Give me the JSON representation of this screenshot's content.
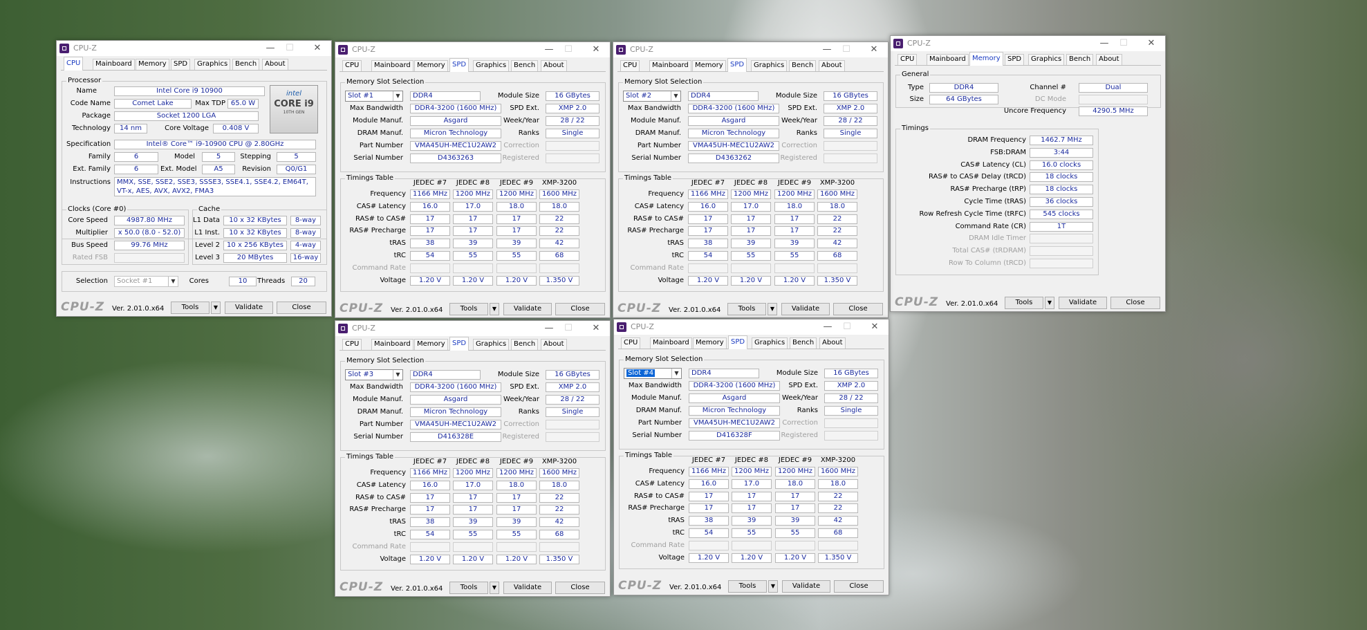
{
  "app": {
    "title": "CPU-Z",
    "tabs": [
      "CPU",
      "Mainboard",
      "Memory",
      "SPD",
      "Graphics",
      "Bench",
      "About"
    ],
    "footer_logo": "CPU-Z",
    "version": "Ver. 2.01.0.x64",
    "tools_label": "Tools",
    "validate_label": "Validate",
    "close_label": "Close",
    "window_buttons": {
      "minimize": "—",
      "maximize": "☐",
      "close": "✕"
    }
  },
  "cpu": {
    "processor_group": "Processor",
    "name_label": "Name",
    "name": "Intel Core i9 10900",
    "codename_label": "Code Name",
    "codename": "Comet Lake",
    "maxtdp_label": "Max TDP",
    "maxtdp": "65.0 W",
    "package_label": "Package",
    "package": "Socket 1200 LGA",
    "technology_label": "Technology",
    "technology": "14 nm",
    "corevoltage_label": "Core Voltage",
    "corevoltage": "0.408 V",
    "spec_label": "Specification",
    "spec": "Intel® Core™ i9-10900 CPU @ 2.80GHz",
    "family_label": "Family",
    "family": "6",
    "model_label": "Model",
    "model": "5",
    "stepping_label": "Stepping",
    "stepping": "5",
    "extfamily_label": "Ext. Family",
    "extfamily": "6",
    "extmodel_label": "Ext. Model",
    "extmodel": "A5",
    "revision_label": "Revision",
    "revision": "Q0/G1",
    "instructions_label": "Instructions",
    "instructions": "MMX, SSE, SSE2, SSE3, SSSE3, SSE4.1, SSE4.2, EM64T, VT-x, AES, AVX, AVX2, FMA3",
    "logo_brand": "intel",
    "logo_core": "CORE i9",
    "logo_gen": "10TH GEN",
    "clocks_group": "Clocks (Core #0)",
    "corespeed_label": "Core Speed",
    "corespeed": "4987.80 MHz",
    "multiplier_label": "Multiplier",
    "multiplier": "x 50.0 (8.0 - 52.0)",
    "busspeed_label": "Bus Speed",
    "busspeed": "99.76 MHz",
    "ratedfsb_label": "Rated FSB",
    "ratedfsb": "",
    "cache_group": "Cache",
    "l1d_label": "L1 Data",
    "l1d": "10 x 32 KBytes",
    "l1d_way": "8-way",
    "l1i_label": "L1 Inst.",
    "l1i": "10 x 32 KBytes",
    "l1i_way": "8-way",
    "l2_label": "Level 2",
    "l2": "10 x 256 KBytes",
    "l2_way": "4-way",
    "l3_label": "Level 3",
    "l3": "20 MBytes",
    "l3_way": "16-way",
    "selection_label": "Selection",
    "selection": "Socket #1",
    "cores_label": "Cores",
    "cores": "10",
    "threads_label": "Threads",
    "threads": "20"
  },
  "memory": {
    "general_group": "General",
    "type_label": "Type",
    "type": "DDR4",
    "size_label": "Size",
    "size": "64 GBytes",
    "channel_label": "Channel #",
    "channel": "Dual",
    "dcmode_label": "DC Mode",
    "dcmode": "",
    "uncore_label": "Uncore Frequency",
    "uncore": "4290.5 MHz",
    "timings_group": "Timings",
    "rows": [
      {
        "label": "DRAM Frequency",
        "value": "1462.7 MHz",
        "disabled": false
      },
      {
        "label": "FSB:DRAM",
        "value": "3:44",
        "disabled": false
      },
      {
        "label": "CAS# Latency (CL)",
        "value": "16.0 clocks",
        "disabled": false
      },
      {
        "label": "RAS# to CAS# Delay (tRCD)",
        "value": "18 clocks",
        "disabled": false
      },
      {
        "label": "RAS# Precharge (tRP)",
        "value": "18 clocks",
        "disabled": false
      },
      {
        "label": "Cycle Time (tRAS)",
        "value": "36 clocks",
        "disabled": false
      },
      {
        "label": "Row Refresh Cycle Time (tRFC)",
        "value": "545 clocks",
        "disabled": false
      },
      {
        "label": "Command Rate (CR)",
        "value": "1T",
        "disabled": false
      },
      {
        "label": "DRAM Idle Timer",
        "value": "",
        "disabled": true
      },
      {
        "label": "Total CAS# (tRDRAM)",
        "value": "",
        "disabled": true
      },
      {
        "label": "Row To Column (tRCD)",
        "value": "",
        "disabled": true
      }
    ]
  },
  "spd_labels": {
    "slot_group": "Memory Slot Selection",
    "module_size": "Module Size",
    "max_bandwidth": "Max Bandwidth",
    "spd_ext": "SPD Ext.",
    "module_manuf": "Module Manuf.",
    "week_year": "Week/Year",
    "dram_manuf": "DRAM Manuf.",
    "ranks": "Ranks",
    "part_number": "Part Number",
    "correction": "Correction",
    "serial_number": "Serial Number",
    "registered": "Registered",
    "timings_group": "Timings Table",
    "headers": [
      "JEDEC #7",
      "JEDEC #8",
      "JEDEC #9",
      "XMP-3200"
    ],
    "rows": [
      "Frequency",
      "CAS# Latency",
      "RAS# to CAS#",
      "RAS# Precharge",
      "tRAS",
      "tRC",
      "Command Rate",
      "Voltage"
    ]
  },
  "spd_common": {
    "type": "DDR4",
    "module_size": "16 GBytes",
    "max_bandwidth": "DDR4-3200 (1600 MHz)",
    "spd_ext": "XMP 2.0",
    "module_manuf": "Asgard",
    "week_year": "28 / 22",
    "dram_manuf": "Micron Technology",
    "ranks": "Single",
    "part_number": "VMA45UH-MEC1U2AW2",
    "table": [
      [
        "1166 MHz",
        "1200 MHz",
        "1200 MHz",
        "1600 MHz"
      ],
      [
        "16.0",
        "17.0",
        "18.0",
        "18.0"
      ],
      [
        "17",
        "17",
        "17",
        "22"
      ],
      [
        "17",
        "17",
        "17",
        "22"
      ],
      [
        "38",
        "39",
        "39",
        "42"
      ],
      [
        "54",
        "55",
        "55",
        "68"
      ],
      [
        "",
        "",
        "",
        ""
      ],
      [
        "1.20 V",
        "1.20 V",
        "1.20 V",
        "1.350 V"
      ]
    ]
  },
  "spd_slots": [
    {
      "slot": "Slot #1",
      "serial": "D4363263"
    },
    {
      "slot": "Slot #2",
      "serial": "D4363262"
    },
    {
      "slot": "Slot #3",
      "serial": "D416328E"
    },
    {
      "slot": "Slot #4",
      "serial": "D416328F"
    }
  ]
}
